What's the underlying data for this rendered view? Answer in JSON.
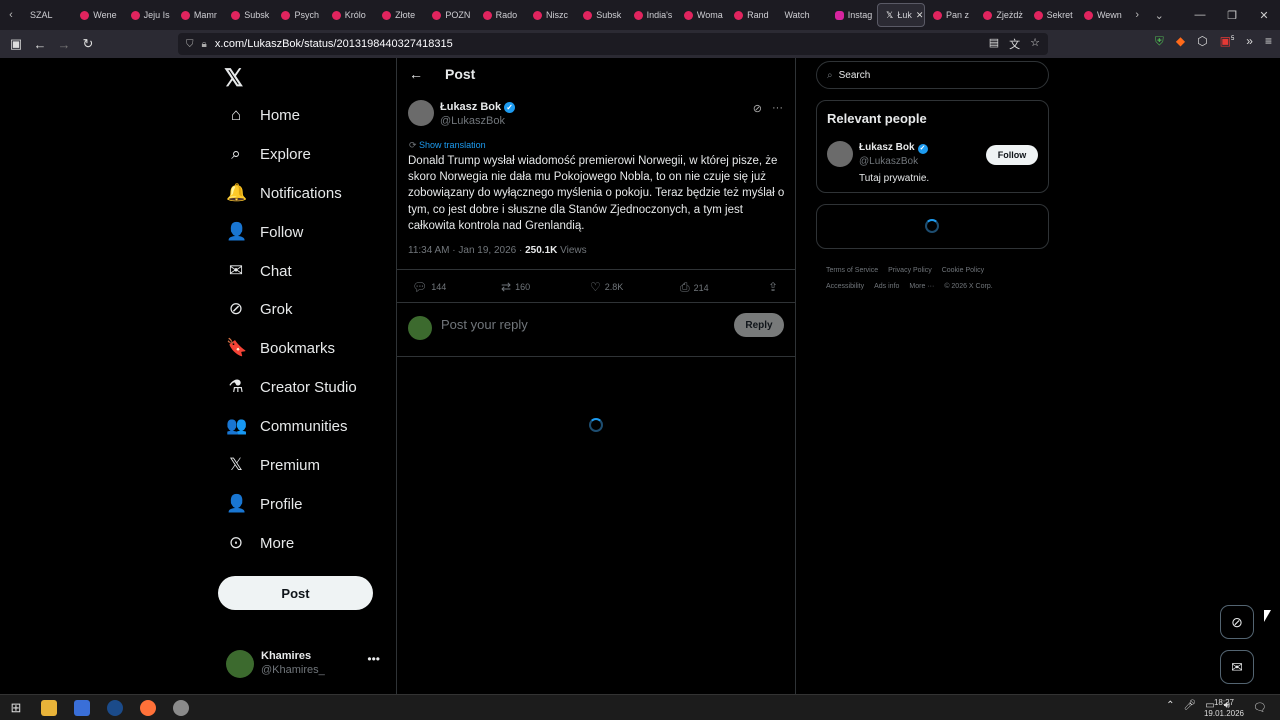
{
  "browser": {
    "tabs": [
      {
        "label": "SZAL"
      },
      {
        "label": "Wene"
      },
      {
        "label": "Jeju Is"
      },
      {
        "label": "Mamr"
      },
      {
        "label": "Subsk"
      },
      {
        "label": "Psych"
      },
      {
        "label": "Królo"
      },
      {
        "label": "Złote"
      },
      {
        "label": "POZN"
      },
      {
        "label": "Rado"
      },
      {
        "label": "Niszc"
      },
      {
        "label": "Subsk"
      },
      {
        "label": "India's"
      },
      {
        "label": "Woma"
      },
      {
        "label": "Rand"
      },
      {
        "label": "Watch"
      },
      {
        "label": "Instag"
      },
      {
        "label": "Łuk"
      },
      {
        "label": "Pan z"
      },
      {
        "label": "Zjeżdż"
      },
      {
        "label": "Sekret"
      },
      {
        "label": "Wewn"
      }
    ],
    "url": "x.com/LukaszBok/status/2013198440327418315",
    "ext_badge": "5"
  },
  "nav": {
    "items": [
      {
        "label": "Home",
        "icon": "home-icon",
        "glyph": "⌂"
      },
      {
        "label": "Explore",
        "icon": "search-icon",
        "glyph": "⌕"
      },
      {
        "label": "Notifications",
        "icon": "bell-icon",
        "glyph": "🔔"
      },
      {
        "label": "Follow",
        "icon": "add-person-icon",
        "glyph": "👤"
      },
      {
        "label": "Chat",
        "icon": "mail-icon",
        "glyph": "✉"
      },
      {
        "label": "Grok",
        "icon": "grok-icon",
        "glyph": "⊘"
      },
      {
        "label": "Bookmarks",
        "icon": "bookmark-icon",
        "glyph": "🔖"
      },
      {
        "label": "Creator Studio",
        "icon": "flask-icon",
        "glyph": "⚗"
      },
      {
        "label": "Communities",
        "icon": "communities-icon",
        "glyph": "👥"
      },
      {
        "label": "Premium",
        "icon": "x-logo-icon",
        "glyph": "𝕏"
      },
      {
        "label": "Profile",
        "icon": "profile-icon",
        "glyph": "👤"
      },
      {
        "label": "More",
        "icon": "more-circle-icon",
        "glyph": "⊙"
      }
    ],
    "post_label": "Post",
    "account": {
      "name": "Khamires",
      "handle": "@Khamires_"
    }
  },
  "main": {
    "header_title": "Post",
    "author": {
      "name": "Łukasz Bok",
      "handle": "@LukaszBok"
    },
    "show_translation": "Show translation",
    "text": "Donald Trump wysłał wiadomość premierowi Norwegii, w której pisze, że skoro Norwegia nie dała mu Pokojowego Nobla, to on nie czuje się już zobowiązany do wyłącznego myślenia o pokoju. Teraz będzie też myślał o tym, co jest dobre i słuszne dla Stanów Zjednoczonych, a tym jest całkowita kontrola nad Grenlandią.",
    "timestamp": "11:34 AM · Jan 19, 2026 · ",
    "views_count": "250.1K",
    "views_label": " Views",
    "stats": {
      "replies": "144",
      "reposts": "160",
      "likes": "2.8K",
      "bookmarks": "214"
    },
    "reply_placeholder": "Post your reply",
    "reply_button": "Reply"
  },
  "sidebar": {
    "search_placeholder": "Search",
    "relevant_title": "Relevant people",
    "person": {
      "name": "Łukasz Bok",
      "handle": "@LukaszBok",
      "bio": "Tutaj prywatnie.",
      "follow_label": "Follow"
    },
    "footer": [
      "Terms of Service",
      "Privacy Policy",
      "Cookie Policy",
      "Accessibility",
      "Ads info",
      "More ···",
      "© 2026 X Corp."
    ]
  },
  "taskbar": {
    "time": "18:27",
    "date": "19.01.2026"
  }
}
